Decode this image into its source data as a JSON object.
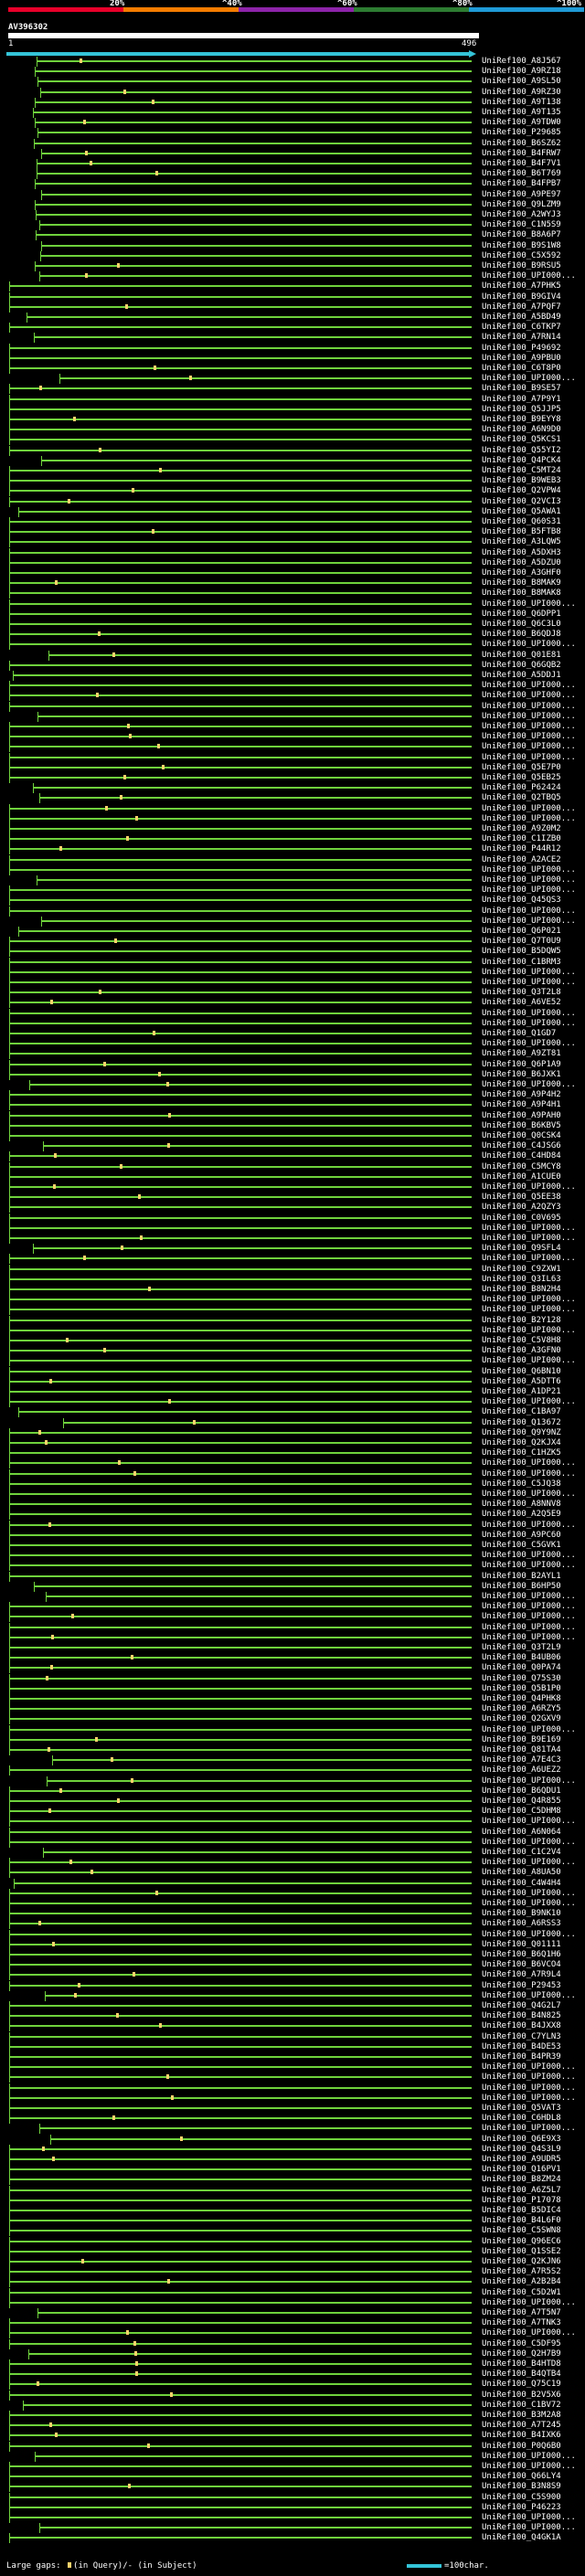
{
  "header": {
    "percent_labels": [
      "20%",
      "^40%",
      "^60%",
      "^80%",
      "^100%"
    ],
    "color_stops": [
      "#e8002a",
      "#f57c00",
      "#8e24aa",
      "#2e7d32",
      "#1f9ad6"
    ]
  },
  "query": {
    "name": "AV396302",
    "start": "1",
    "end": "496"
  },
  "hits": [
    "UniRef100_A8J567",
    "UniRef100_A9RZ18",
    "UniRef100_A9SL50",
    "UniRef100_A9RZ30",
    "UniRef100_A9T138",
    "UniRef100_A9T135",
    "UniRef100_A9TDW0",
    "UniRef100_P29685",
    "UniRef100_B6SZ62",
    "UniRef100_B4FRW7",
    "UniRef100_B4F7V1",
    "UniRef100_B6T769",
    "UniRef100_B4FPB7",
    "UniRef100_A9PE97",
    "UniRef100_Q9LZM9",
    "UniRef100_A2WYJ3",
    "UniRef100_C1N5S9",
    "UniRef100_B8A6P7",
    "UniRef100_B9S1W8",
    "UniRef100_C5X592",
    "UniRef100_B9RSU5",
    "UniRef100_UPI000...",
    "UniRef100_A7PHK5",
    "UniRef100_B9GIV4",
    "UniRef100_A7PQF7",
    "UniRef100_A5BD49",
    "UniRef100_C6TKP7",
    "UniRef100_A7RN14",
    "UniRef100_P49692",
    "UniRef100_A9PBU0",
    "UniRef100_C6T8P0",
    "UniRef100_UPI000...",
    "UniRef100_B9SE57",
    "UniRef100_A7P9Y1",
    "UniRef100_Q5JJP5",
    "UniRef100_B9EYY8",
    "UniRef100_A6N9D0",
    "UniRef100_Q5KCS1",
    "UniRef100_Q55YI2",
    "UniRef100_Q4PCK4",
    "UniRef100_C5MT24",
    "UniRef100_B9WEB3",
    "UniRef100_Q2VPW4",
    "UniRef100_Q2VCI3",
    "UniRef100_Q5AWA1",
    "UniRef100_Q60S31",
    "UniRef100_B5FTB8",
    "UniRef100_A3LQW5",
    "UniRef100_A5DXH3",
    "UniRef100_A5DZU0",
    "UniRef100_A3GHF0",
    "UniRef100_B8MAK9",
    "UniRef100_B8MAK8",
    "UniRef100_UPI000...",
    "UniRef100_Q6DPP1",
    "UniRef100_Q6C3L0",
    "UniRef100_B6QDJ8",
    "UniRef100_UPI000...",
    "UniRef100_Q01E81",
    "UniRef100_Q6GQB2",
    "UniRef100_A5DDJ1",
    "UniRef100_UPI000...",
    "UniRef100_UPI000...",
    "UniRef100_UPI000...",
    "UniRef100_UPI000...",
    "UniRef100_UPI000...",
    "UniRef100_UPI000...",
    "UniRef100_UPI000...",
    "UniRef100_UPI000...",
    "UniRef100_Q5E7P0",
    "UniRef100_Q5EB25",
    "UniRef100_P62424",
    "UniRef100_Q2TBQ5",
    "UniRef100_UPI000...",
    "UniRef100_UPI000...",
    "UniRef100_A9Z0M2",
    "UniRef100_C1IZB0",
    "UniRef100_P44R12",
    "UniRef100_A2ACE2",
    "UniRef100_UPI000...",
    "UniRef100_UPI000...",
    "UniRef100_UPI000...",
    "UniRef100_Q45QS3",
    "UniRef100_UPI000...",
    "UniRef100_UPI000...",
    "UniRef100_Q6P021",
    "UniRef100_Q7T0U9",
    "UniRef100_B5DQW5",
    "UniRef100_C1BRM3",
    "UniRef100_UPI000...",
    "UniRef100_UPI000...",
    "UniRef100_Q3T2L8",
    "UniRef100_A6VE52",
    "UniRef100_UPI000...",
    "UniRef100_UPI000...",
    "UniRef100_Q1GD7",
    "UniRef100_UPI000...",
    "UniRef100_A9ZT81",
    "UniRef100_Q6P1A9",
    "UniRef100_B6JXK1",
    "UniRef100_UPI000...",
    "UniRef100_A9P4H2",
    "UniRef100_A9P4H1",
    "UniRef100_A9PAH0",
    "UniRef100_B6KBV5",
    "UniRef100_Q0CSK4",
    "UniRef100_C4JSG6",
    "UniRef100_C4HD84",
    "UniRef100_C5MCY8",
    "UniRef100_A1CUE0",
    "UniRef100_UPI000...",
    "UniRef100_Q5EE38",
    "UniRef100_A2QZY3",
    "UniRef100_C0V695",
    "UniRef100_UPI000...",
    "UniRef100_UPI000...",
    "UniRef100_Q9SFL4",
    "UniRef100_UPI000...",
    "UniRef100_C9ZXW1",
    "UniRef100_Q3IL63",
    "UniRef100_B8N2H4",
    "UniRef100_UPI000...",
    "UniRef100_UPI000...",
    "UniRef100_B2Y128",
    "UniRef100_UPI000...",
    "UniRef100_C5V8H8",
    "UniRef100_A3GFN0",
    "UniRef100_UPI000...",
    "UniRef100_Q6BN10",
    "UniRef100_A5DTT6",
    "UniRef100_A1DP21",
    "UniRef100_UPI000...",
    "UniRef100_C1BA97",
    "UniRef100_Q13672",
    "UniRef100_Q9Y9NZ",
    "UniRef100_Q2KJX4",
    "UniRef100_C1HZK5",
    "UniRef100_UPI000...",
    "UniRef100_UPI000...",
    "UniRef100_C5JQ38",
    "UniRef100_UPI000...",
    "UniRef100_A8NNV8",
    "UniRef100_A2Q5E9",
    "UniRef100_UPI000...",
    "UniRef100_A9PC60",
    "UniRef100_C5GVK1",
    "UniRef100_UPI000...",
    "UniRef100_UPI000...",
    "UniRef100_B2AYL1",
    "UniRef100_B6HP50",
    "UniRef100_UPI000...",
    "UniRef100_UPI000...",
    "UniRef100_UPI000...",
    "UniRef100_UPI000...",
    "UniRef100_UPI000...",
    "UniRef100_Q3T2L9",
    "UniRef100_B4UB06",
    "UniRef100_Q0PA74",
    "UniRef100_Q75S30",
    "UniRef100_Q5B1P0",
    "UniRef100_Q4PHK8",
    "UniRef100_A6RZY5",
    "UniRef100_Q2GXV9",
    "UniRef100_UPI000...",
    "UniRef100_B9E169",
    "UniRef100_Q81TA4",
    "UniRef100_A7E4C3",
    "UniRef100_A6UEZ2",
    "UniRef100_UPI000...",
    "UniRef100_B6QDU1",
    "UniRef100_Q4R855",
    "UniRef100_C5DHM8",
    "UniRef100_UPI000...",
    "UniRef100_A6N064",
    "UniRef100_UPI000...",
    "UniRef100_C1C2V4",
    "UniRef100_UPI000...",
    "UniRef100_A8UA50",
    "UniRef100_C4W4H4",
    "UniRef100_UPI000...",
    "UniRef100_UPI000...",
    "UniRef100_B9NK10",
    "UniRef100_A6RSS3",
    "UniRef100_UPI000...",
    "UniRef100_Q01111",
    "UniRef100_B6Q1H6",
    "UniRef100_B6VCO4",
    "UniRef100_A7R9L4",
    "UniRef100_P29453",
    "UniRef100_UPI000...",
    "UniRef100_Q4G2L7",
    "UniRef100_B4N825",
    "UniRef100_B4JXX8",
    "UniRef100_C7YLN3",
    "UniRef100_B4DE53",
    "UniRef100_B4PR39",
    "UniRef100_UPI000...",
    "UniRef100_UPI000...",
    "UniRef100_UPI000...",
    "UniRef100_UPI000...",
    "UniRef100_Q5VAT3",
    "UniRef100_C6HDL8",
    "UniRef100_UPI000...",
    "UniRef100_Q6E9X3",
    "UniRef100_Q4S3L9",
    "UniRef100_A9UDR5",
    "UniRef100_Q16PV1",
    "UniRef100_B8ZM24",
    "UniRef100_A6Z5L7",
    "UniRef100_P17078",
    "UniRef100_B5DIC4",
    "UniRef100_B4L6F0",
    "UniRef100_C5SWN8",
    "UniRef100_Q96EC6",
    "UniRef100_Q1SSE2",
    "UniRef100_Q2KJN6",
    "UniRef100_A7R5S2",
    "UniRef100_A2B2B4",
    "UniRef100_C5D2W1",
    "UniRef100_UPI000...",
    "UniRef100_A7T5N7",
    "UniRef100_A7TNK3",
    "UniRef100_UPI000...",
    "UniRef100_C5DF95",
    "UniRef100_Q2H7B9",
    "UniRef100_B4HTD8",
    "UniRef100_B4QTB4",
    "UniRef100_Q75C19",
    "UniRef100_B2V5X6",
    "UniRef100_C1BV72",
    "UniRef100_B3M2A8",
    "UniRef100_A7T245",
    "UniRef100_B4IXK6",
    "UniRef100_P0Q6B0",
    "UniRef100_UPI000...",
    "UniRef100_UPI000...",
    "UniRef100_Q66LY4",
    "UniRef100_B3N8S9",
    "UniRef100_C5S900",
    "UniRef100_P46223",
    "UniRef100_UPI000...",
    "UniRef100_UPI000...",
    "UniRef100_Q4GK1A"
  ],
  "legend": {
    "gaps_label": "Large gaps:",
    "query_gap_label": "(in Query)",
    "subject_gap_label": "/- (in Subject)",
    "scale_label": "=100char."
  }
}
